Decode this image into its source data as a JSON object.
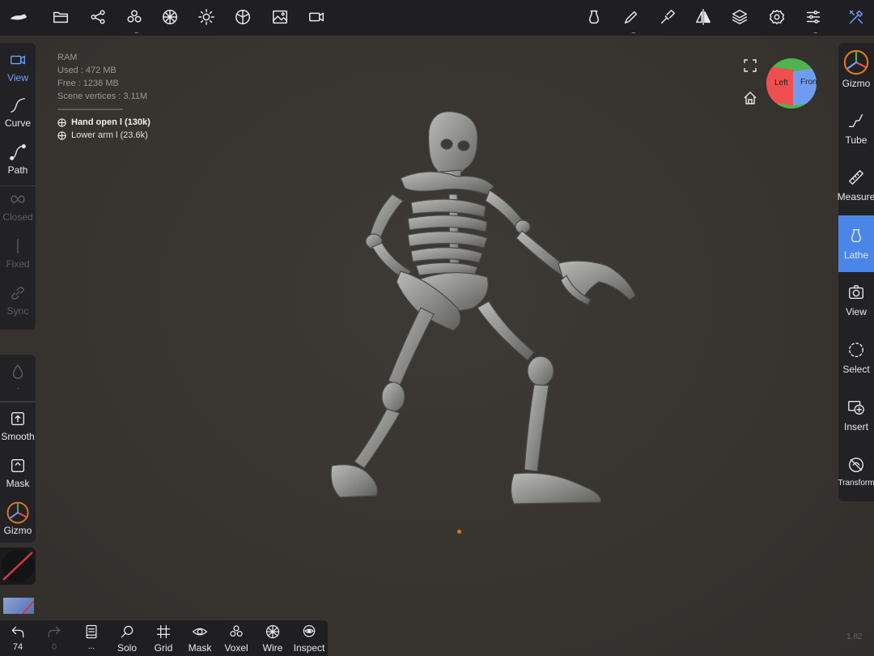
{
  "top_toolbar": {
    "left_icons": [
      "logo-icon",
      "folder-icon",
      "scene-graph-icon",
      "multiresolution-icon",
      "topology-icon",
      "lighting-icon",
      "material-icon",
      "background-icon",
      "camera-icon"
    ],
    "right_icons": [
      "lathe-tool-icon",
      "brush-icon",
      "paint-icon",
      "symmetry-icon",
      "layers-icon",
      "settings-icon",
      "sliders-icon",
      "tools-icon"
    ],
    "more_indicator": "..."
  },
  "info": {
    "ram_label": "RAM",
    "used": "Used : 472 MB",
    "free": "Free : 1236 MB",
    "vertices": "Scene vertices : 3.11M",
    "separator": "------------------------------",
    "meshes": [
      "Hand open l (130k)",
      "Lower arm l (23.6k)"
    ]
  },
  "left_panel": {
    "top_tools": [
      {
        "label": "View",
        "state": "active"
      },
      {
        "label": "Curve",
        "state": "normal"
      },
      {
        "label": "Path",
        "state": "normal"
      },
      {
        "label": "Closed",
        "state": "disabled"
      },
      {
        "label": "Fixed",
        "state": "disabled"
      },
      {
        "label": "Sync",
        "state": "disabled"
      }
    ],
    "bottom_tools": [
      {
        "label": "Smooth"
      },
      {
        "label": "Mask"
      },
      {
        "label": "Gizmo"
      }
    ],
    "drop_indicator": "-"
  },
  "right_panel": {
    "tools": [
      {
        "label": "Gizmo"
      },
      {
        "label": "Tube"
      },
      {
        "label": "Measure"
      },
      {
        "label": "Lathe",
        "selected": true
      },
      {
        "label": "View"
      },
      {
        "label": "Select"
      },
      {
        "label": "Insert"
      },
      {
        "label": "Transform"
      }
    ]
  },
  "view_cube": {
    "left_face": "Left",
    "front_face": "Front"
  },
  "bottom_toolbar": {
    "undo_count": "74",
    "redo_count": "0",
    "more_label": "...",
    "items": [
      "Solo",
      "Grid",
      "Mask",
      "Voxel",
      "Wire",
      "Inspect"
    ]
  },
  "version": "1.82",
  "colors": {
    "accent": "#4a86e8",
    "toolbar": "#1f1f22",
    "background": "#3a3632",
    "pivot": "#e2761c"
  }
}
